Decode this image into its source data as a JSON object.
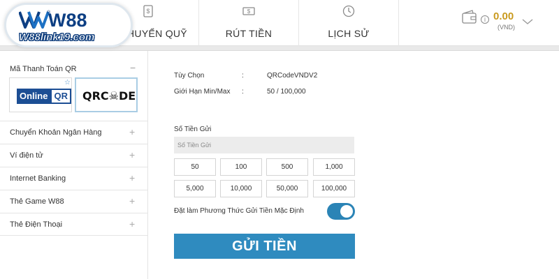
{
  "brand": {
    "name": "W88",
    "registered": "®",
    "site": "W88link19.com"
  },
  "tabs": [
    {
      "label": "HUYỂN QUỸ",
      "icon": "deposit-icon"
    },
    {
      "label": "RÚT TIỀN",
      "icon": "withdraw-icon"
    },
    {
      "label": "LỊCH SỬ",
      "icon": "history-icon"
    }
  ],
  "wallet": {
    "balance": "0.00",
    "currency": "(VND)",
    "info": "i"
  },
  "sidebar": {
    "header": "Mã Thanh Toán QR",
    "collapse_symbol": "−",
    "expand_symbol": "+",
    "qr_options": [
      {
        "text_a": "Online",
        "text_b": "QR",
        "star": "☆"
      },
      {
        "text": "QRC☠DE"
      }
    ],
    "items": [
      {
        "label": "Chuyển Khoản Ngân Hàng"
      },
      {
        "label": "Ví điện tử"
      },
      {
        "label": "Internet Banking"
      },
      {
        "label": "Thẻ Game W88"
      },
      {
        "label": "Thẻ Điện Thoại"
      }
    ]
  },
  "details": {
    "option_label": "Tùy Chọn",
    "option_value": "QRCodeVNDV2",
    "limit_label": "Giới Hạn Min/Max",
    "limit_value": "50 / 100,000",
    "colon": ":"
  },
  "amount": {
    "label": "Số Tiền Gửi",
    "placeholder": "Số Tiền Gửi",
    "quick": [
      "50",
      "100",
      "500",
      "1,000",
      "5,000",
      "10,000",
      "50,000",
      "100,000"
    ]
  },
  "default_method": {
    "label": "Đặt làm Phương Thức Gửi Tiền Mặc Định",
    "enabled": true
  },
  "submit_label": "GỬI TIỀN",
  "colors": {
    "accent": "#2f8bbf",
    "brand": "#0d3f83",
    "balance": "#c99a1f"
  }
}
